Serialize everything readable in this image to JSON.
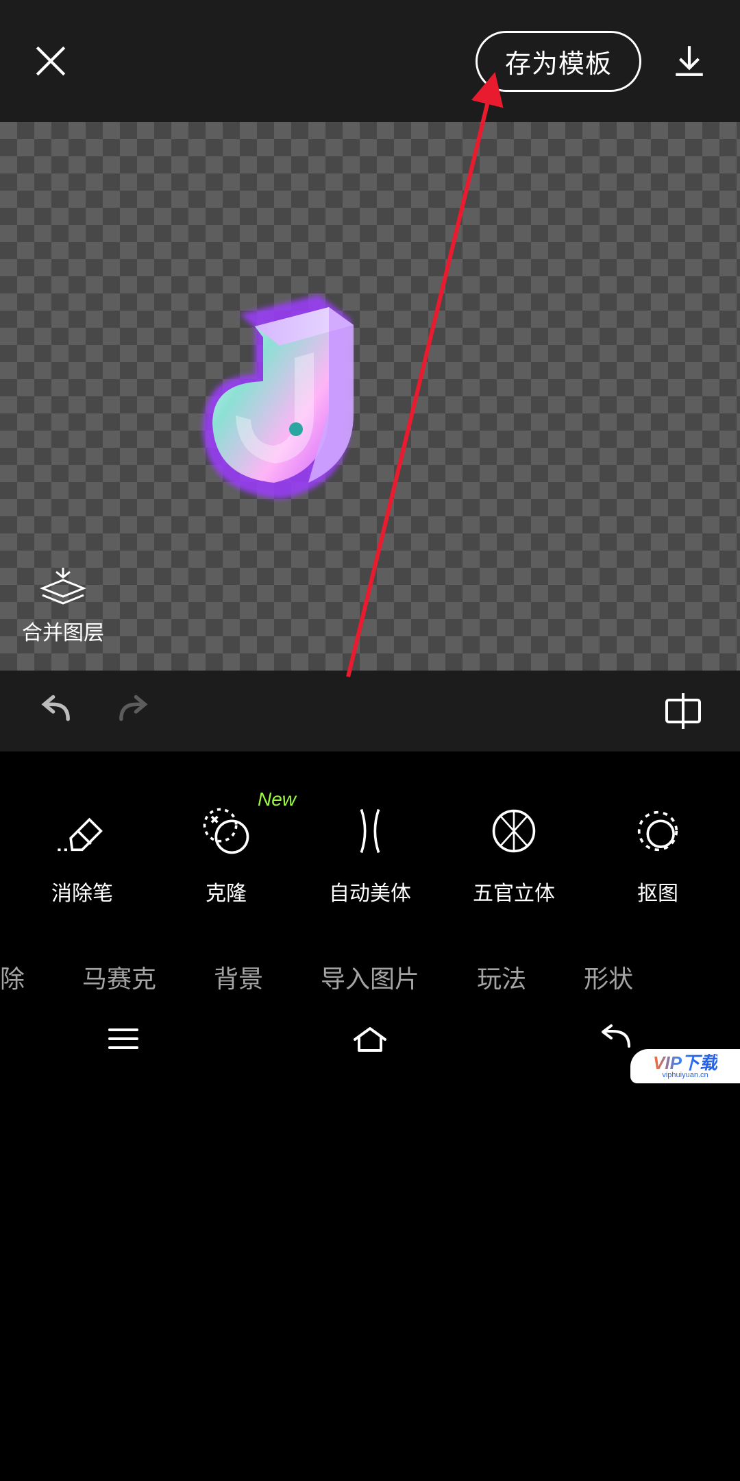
{
  "topbar": {
    "save_template_label": "存为模板"
  },
  "canvas": {
    "merge_layers_label": "合并图层"
  },
  "tools": [
    {
      "id": "eraser",
      "label": "消除笔",
      "badge": null
    },
    {
      "id": "clone",
      "label": "克隆",
      "badge": "New"
    },
    {
      "id": "autobody",
      "label": "自动美体",
      "badge": null
    },
    {
      "id": "face3d",
      "label": "五官立体",
      "badge": null
    },
    {
      "id": "cutout",
      "label": "抠图",
      "badge": null
    }
  ],
  "tabs": [
    {
      "id": "remove_partial",
      "label": "除"
    },
    {
      "id": "mosaic",
      "label": "马赛克"
    },
    {
      "id": "background",
      "label": "背景"
    },
    {
      "id": "import_image",
      "label": "导入图片"
    },
    {
      "id": "play",
      "label": "玩法"
    },
    {
      "id": "shape",
      "label": "形状"
    }
  ],
  "watermark": {
    "brand": "VIP下载",
    "url_text": "viphuiyuan.cn"
  },
  "annotation": {
    "arrow_color": "#e81c2e"
  }
}
